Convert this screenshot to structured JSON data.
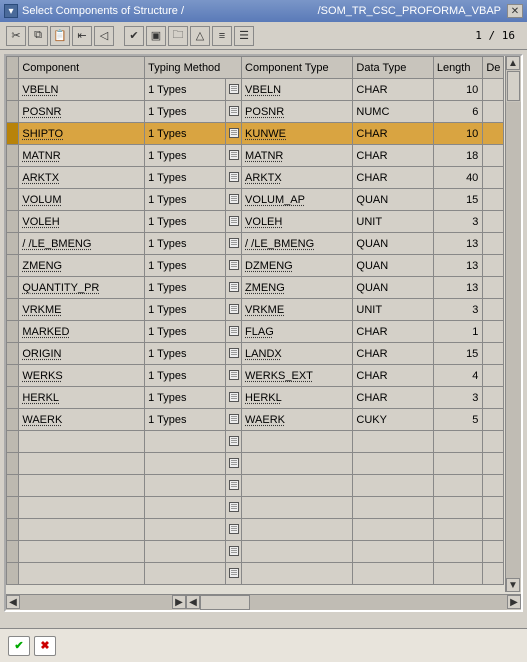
{
  "title": {
    "left": "Select Components of Structure /",
    "right": "/SOM_TR_CSC_PROFORMA_VBAP"
  },
  "page_indicator": "1 / 16",
  "columns": {
    "component": "Component",
    "typing": "Typing Method",
    "comptype": "Component Type",
    "datatype": "Data Type",
    "length": "Length",
    "de": "De"
  },
  "chart_data": {
    "type": "table",
    "title": "Select Components of Structure /SOM_TR_CSC_PROFORMA_VBAP",
    "columns": [
      "Component",
      "Typing Method",
      "Component Type",
      "Data Type",
      "Length"
    ],
    "rows": [
      [
        "VBELN",
        "1 Types",
        "VBELN",
        "CHAR",
        10
      ],
      [
        "POSNR",
        "1 Types",
        "POSNR",
        "NUMC",
        6
      ],
      [
        "SHIPTO",
        "1 Types",
        "KUNWE",
        "CHAR",
        10
      ],
      [
        "MATNR",
        "1 Types",
        "MATNR",
        "CHAR",
        18
      ],
      [
        "ARKTX",
        "1 Types",
        "ARKTX",
        "CHAR",
        40
      ],
      [
        "VOLUM",
        "1 Types",
        "VOLUM_AP",
        "QUAN",
        15
      ],
      [
        "VOLEH",
        "1 Types",
        "VOLEH",
        "UNIT",
        3
      ],
      [
        "/     /LE_BMENG",
        "1 Types",
        "/     /LE_BMENG",
        "QUAN",
        13
      ],
      [
        "ZMENG",
        "1 Types",
        "DZMENG",
        "QUAN",
        13
      ],
      [
        "QUANTITY_PR",
        "1 Types",
        "ZMENG",
        "QUAN",
        13
      ],
      [
        "VRKME",
        "1 Types",
        "VRKME",
        "UNIT",
        3
      ],
      [
        "MARKED",
        "1 Types",
        "FLAG",
        "CHAR",
        1
      ],
      [
        "ORIGIN",
        "1 Types",
        "LANDX",
        "CHAR",
        15
      ],
      [
        "WERKS",
        "1 Types",
        "WERKS_EXT",
        "CHAR",
        4
      ],
      [
        "HERKL",
        "1 Types",
        "HERKL",
        "CHAR",
        3
      ],
      [
        "WAERK",
        "1 Types",
        "WAERK",
        "CUKY",
        5
      ]
    ],
    "selected_row_index": 2
  },
  "rows": [
    {
      "component": "VBELN",
      "typing": "1 Types",
      "comptype": "VBELN",
      "datatype": "CHAR",
      "length": "10",
      "selected": false
    },
    {
      "component": "POSNR",
      "typing": "1 Types",
      "comptype": "POSNR",
      "datatype": "NUMC",
      "length": "6",
      "selected": false
    },
    {
      "component": "SHIPTO",
      "typing": "1 Types",
      "comptype": "KUNWE",
      "datatype": "CHAR",
      "length": "10",
      "selected": true
    },
    {
      "component": "MATNR",
      "typing": "1 Types",
      "comptype": "MATNR",
      "datatype": "CHAR",
      "length": "18",
      "selected": false
    },
    {
      "component": "ARKTX",
      "typing": "1 Types",
      "comptype": "ARKTX",
      "datatype": "CHAR",
      "length": "40",
      "selected": false
    },
    {
      "component": "VOLUM",
      "typing": "1 Types",
      "comptype": "VOLUM_AP",
      "datatype": "QUAN",
      "length": "15",
      "selected": false
    },
    {
      "component": "VOLEH",
      "typing": "1 Types",
      "comptype": "VOLEH",
      "datatype": "UNIT",
      "length": "3",
      "selected": false
    },
    {
      "component": "/     /LE_BMENG",
      "typing": "1 Types",
      "comptype": "/     /LE_BMENG",
      "datatype": "QUAN",
      "length": "13",
      "selected": false
    },
    {
      "component": "ZMENG",
      "typing": "1 Types",
      "comptype": "DZMENG",
      "datatype": "QUAN",
      "length": "13",
      "selected": false
    },
    {
      "component": "QUANTITY_PR",
      "typing": "1 Types",
      "comptype": "ZMENG",
      "datatype": "QUAN",
      "length": "13",
      "selected": false
    },
    {
      "component": "VRKME",
      "typing": "1 Types",
      "comptype": "VRKME",
      "datatype": "UNIT",
      "length": "3",
      "selected": false
    },
    {
      "component": "MARKED",
      "typing": "1 Types",
      "comptype": "FLAG",
      "datatype": "CHAR",
      "length": "1",
      "selected": false
    },
    {
      "component": "ORIGIN",
      "typing": "1 Types",
      "comptype": "LANDX",
      "datatype": "CHAR",
      "length": "15",
      "selected": false
    },
    {
      "component": "WERKS",
      "typing": "1 Types",
      "comptype": "WERKS_EXT",
      "datatype": "CHAR",
      "length": "4",
      "selected": false
    },
    {
      "component": "HERKL",
      "typing": "1 Types",
      "comptype": "HERKL",
      "datatype": "CHAR",
      "length": "3",
      "selected": false
    },
    {
      "component": "WAERK",
      "typing": "1 Types",
      "comptype": "WAERK",
      "datatype": "CUKY",
      "length": "5",
      "selected": false
    }
  ],
  "empty_rows": 7,
  "toolbar_icons": [
    "cut",
    "copy",
    "paste",
    "first",
    "prev",
    "check",
    "open",
    "folder",
    "up",
    "list",
    "props"
  ]
}
